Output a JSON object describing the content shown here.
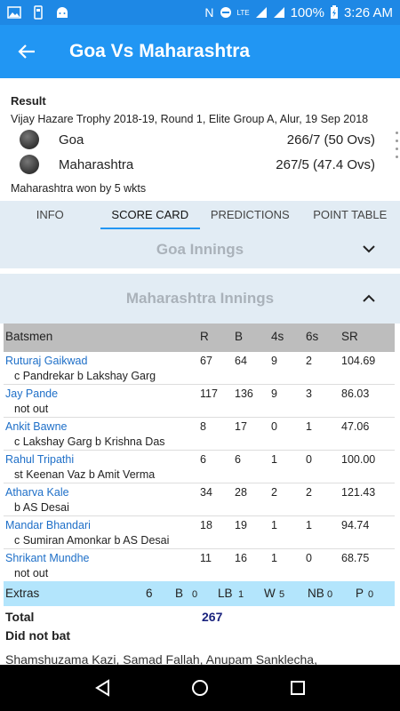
{
  "status_bar": {
    "battery": "100%",
    "time": "3:26 AM",
    "network": "LTE"
  },
  "app_bar": {
    "title": "Goa Vs Maharashtra"
  },
  "result": {
    "label": "Result",
    "description": "Vijay Hazare Trophy 2018-19, Round 1, Elite Group A, Alur, 19 Sep 2018",
    "teams": [
      {
        "name": "Goa",
        "score": "266/7 (50 Ovs)"
      },
      {
        "name": "Maharashtra",
        "score": "267/5 (47.4 Ovs)"
      }
    ],
    "outcome": "Maharashtra won by 5 wkts"
  },
  "tabs": [
    "INFO",
    "SCORE CARD",
    "PREDICTIONS",
    "POINT TABLE"
  ],
  "innings": [
    "Goa Innings",
    "Maharashtra Innings"
  ],
  "scorecard": {
    "headers": [
      "Batsmen",
      "R",
      "B",
      "4s",
      "6s",
      "SR"
    ],
    "batsmen": [
      {
        "name": "Ruturaj Gaikwad",
        "dismissal": "c Pandrekar b Lakshay Garg",
        "r": "67",
        "b": "64",
        "fours": "9",
        "sixes": "2",
        "sr": "104.69"
      },
      {
        "name": "Jay Pande",
        "dismissal": "not out",
        "r": "117",
        "b": "136",
        "fours": "9",
        "sixes": "3",
        "sr": "86.03"
      },
      {
        "name": "Ankit Bawne",
        "dismissal": "c Lakshay Garg b Krishna Das",
        "r": "8",
        "b": "17",
        "fours": "0",
        "sixes": "1",
        "sr": "47.06"
      },
      {
        "name": "Rahul Tripathi",
        "dismissal": "st Keenan Vaz b Amit Verma",
        "r": "6",
        "b": "6",
        "fours": "1",
        "sixes": "0",
        "sr": "100.00"
      },
      {
        "name": "Atharva Kale",
        "dismissal": "b AS Desai",
        "r": "34",
        "b": "28",
        "fours": "2",
        "sixes": "2",
        "sr": "121.43"
      },
      {
        "name": "Mandar Bhandari",
        "dismissal": "c Sumiran Amonkar b AS Desai",
        "r": "18",
        "b": "19",
        "fours": "1",
        "sixes": "1",
        "sr": "94.74"
      },
      {
        "name": "Shrikant Mundhe",
        "dismissal": "not out",
        "r": "11",
        "b": "16",
        "fours": "1",
        "sixes": "0",
        "sr": "68.75"
      }
    ],
    "extras": {
      "label": "Extras",
      "total": "6",
      "b_label": "B",
      "b": "0",
      "lb_label": "LB",
      "lb": "1",
      "w_label": "W",
      "w": "5",
      "nb_label": "NB",
      "nb": "0",
      "p_label": "P",
      "p": "0"
    },
    "total_label": "Total",
    "total": "267",
    "did_not_bat_label": "Did not bat",
    "did_not_bat": "Shamshuzama Kazi, Samad Fallah, Anupam Sanklecha,"
  },
  "colors": {
    "primary": "#2196f3",
    "status": "#1e88e5",
    "link": "#1e6fc8",
    "extras_bg": "#b3e5fc"
  }
}
